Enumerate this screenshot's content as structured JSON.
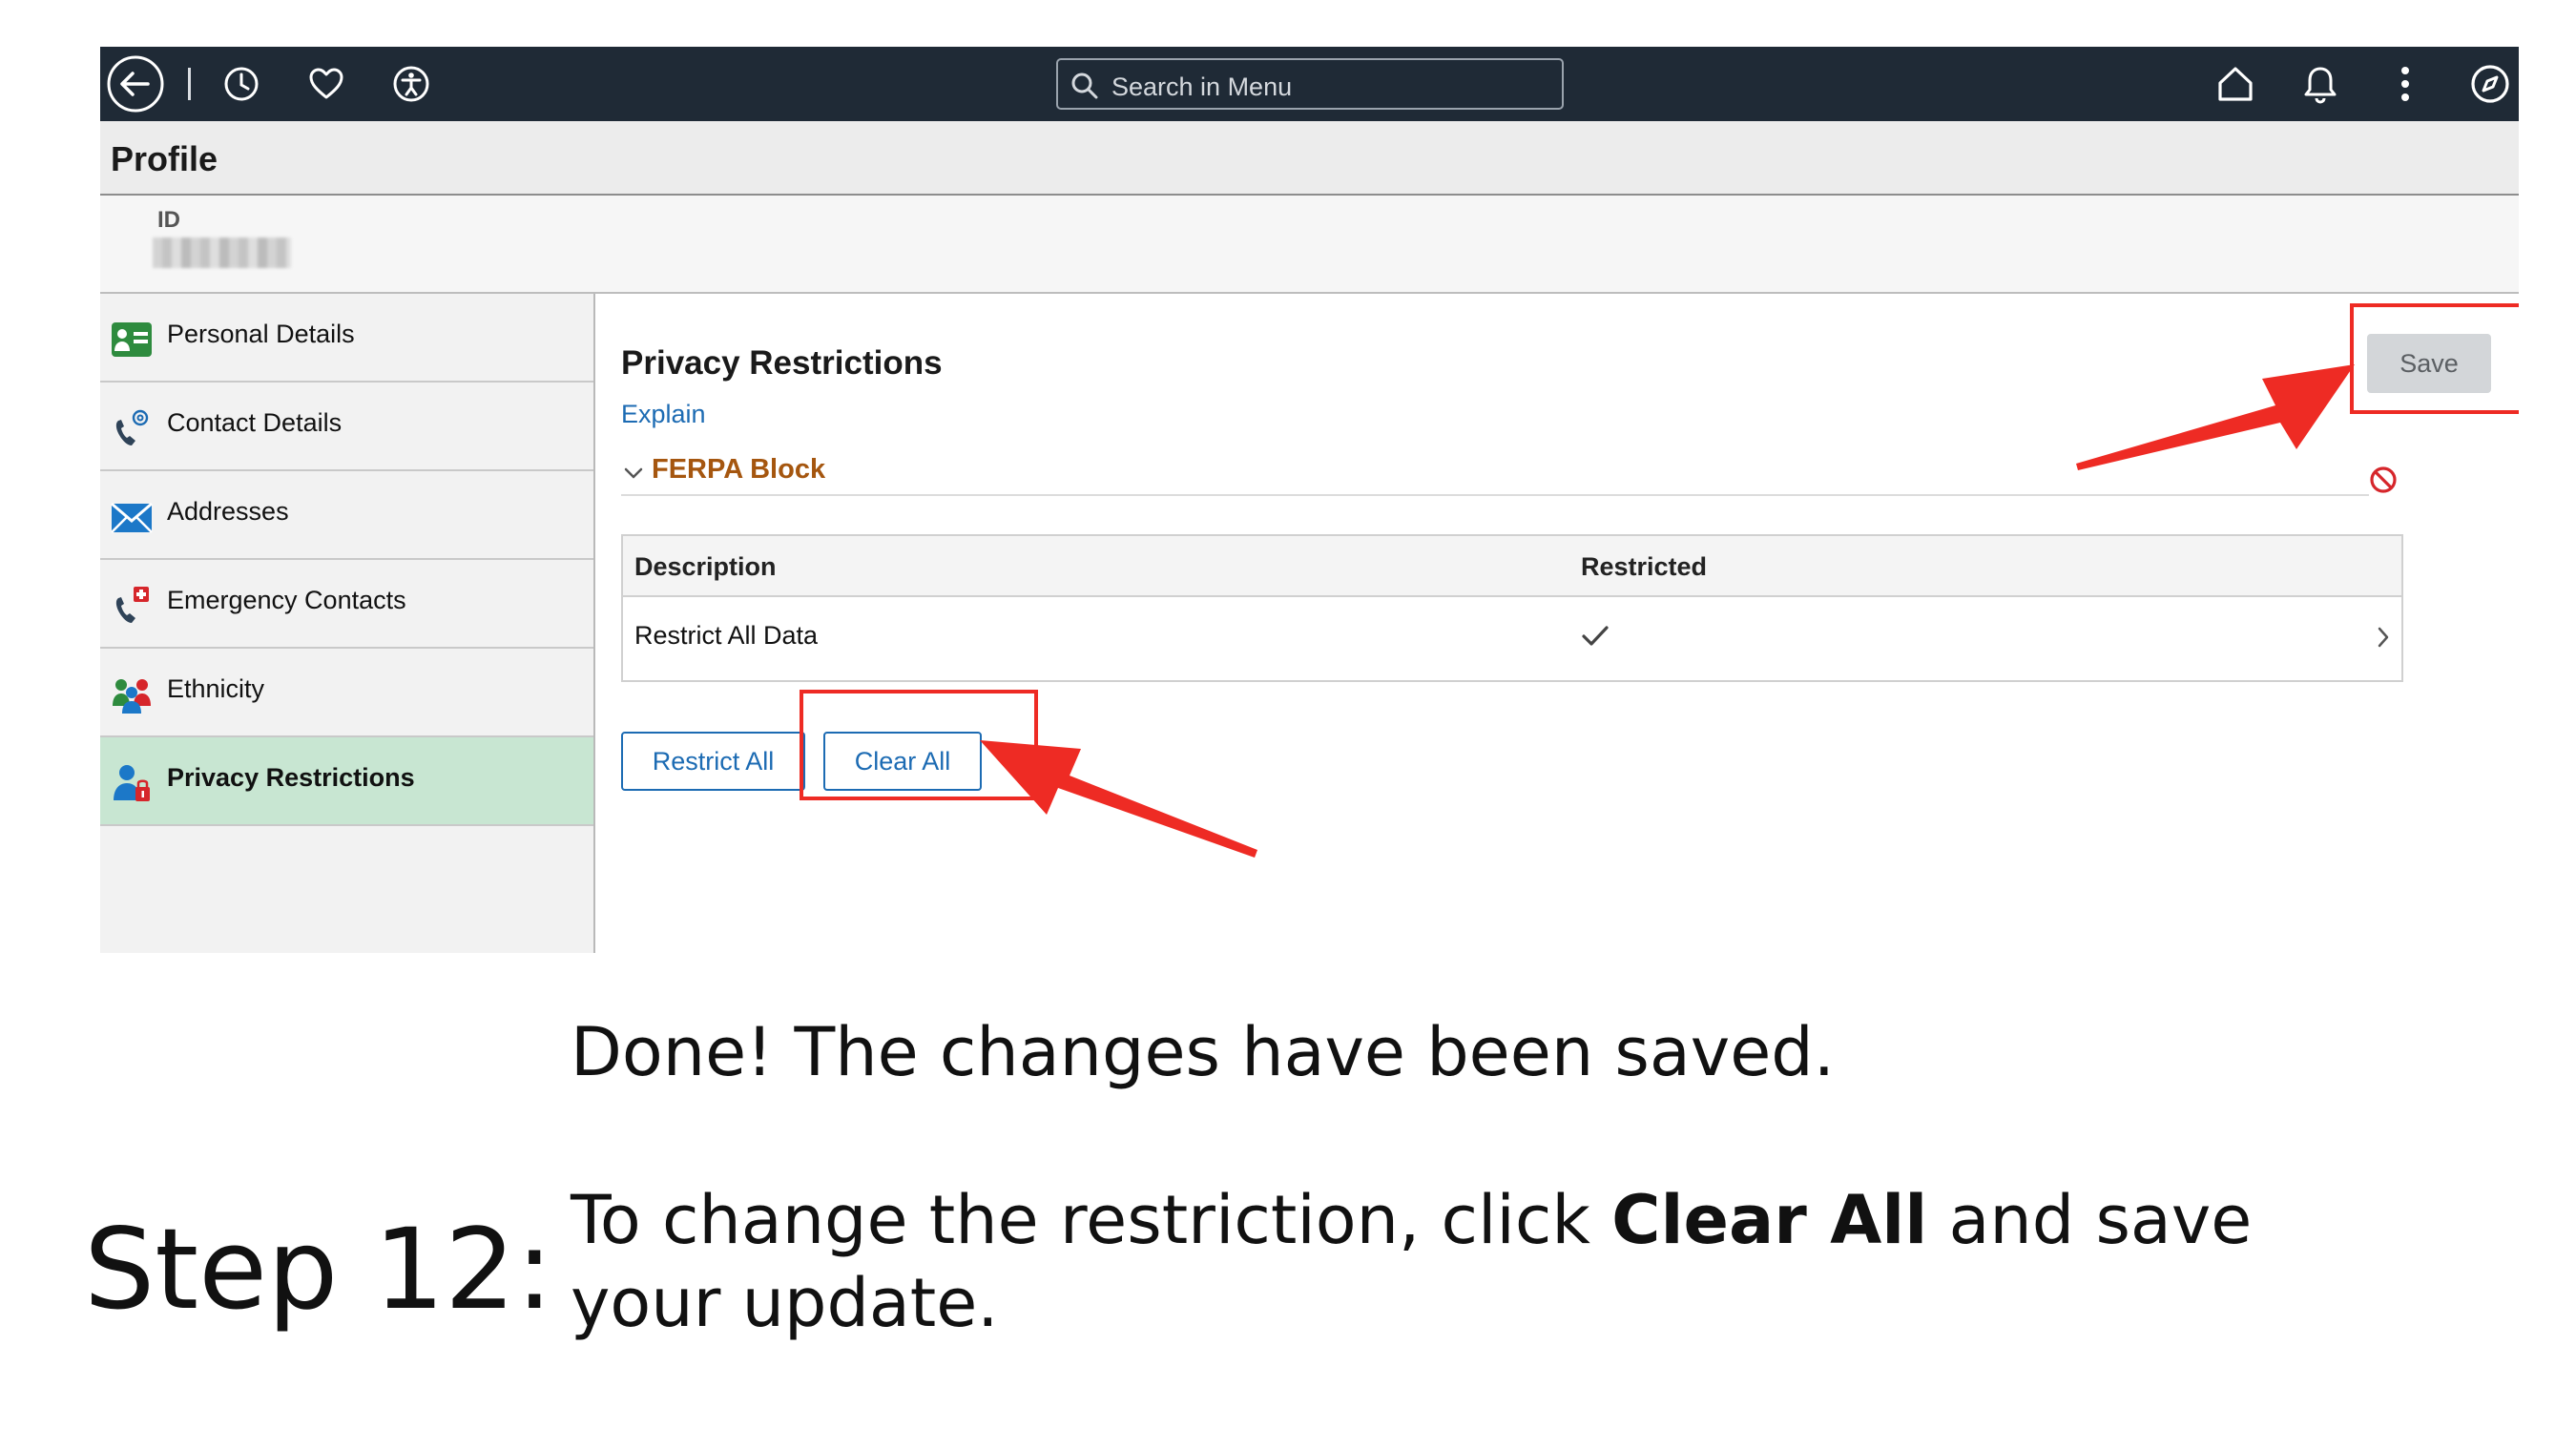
{
  "header": {
    "search_placeholder": "Search in Menu",
    "icons": [
      "back-icon",
      "history-icon",
      "favorites-icon",
      "accessibility-icon",
      "home-icon",
      "notifications-icon",
      "more-actions-icon",
      "navigator-icon"
    ]
  },
  "page": {
    "title": "Profile",
    "id_label": "ID"
  },
  "sidebar": {
    "items": [
      {
        "label": "Personal Details",
        "icon": "personal-details-icon"
      },
      {
        "label": "Contact Details",
        "icon": "contact-details-icon"
      },
      {
        "label": "Addresses",
        "icon": "addresses-icon"
      },
      {
        "label": "Emergency Contacts",
        "icon": "emergency-contacts-icon"
      },
      {
        "label": "Ethnicity",
        "icon": "ethnicity-icon"
      },
      {
        "label": "Privacy Restrictions",
        "icon": "privacy-restrictions-icon",
        "active": true
      }
    ]
  },
  "main": {
    "title": "Privacy Restrictions",
    "explain_link": "Explain",
    "save_label": "Save",
    "section": {
      "title": "FERPA Block",
      "columns": [
        "Description",
        "Restricted"
      ],
      "rows": [
        {
          "description": "Restrict All Data",
          "restricted": true
        }
      ]
    },
    "restrict_all_label": "Restrict All",
    "clear_all_label": "Clear All"
  },
  "instructions": {
    "done": "Done! The changes have been saved.",
    "step_label": "Step 12:",
    "text_before": "To change the restriction, click ",
    "text_bold": "Clear All",
    "text_after": " and save your update."
  },
  "colors": {
    "topbar": "#1f2a36",
    "accent_link": "#1c6bb3",
    "ferpa_title": "#a5560f",
    "active_nav": "#c8e6d2",
    "annotation_red": "#ee2b24"
  }
}
